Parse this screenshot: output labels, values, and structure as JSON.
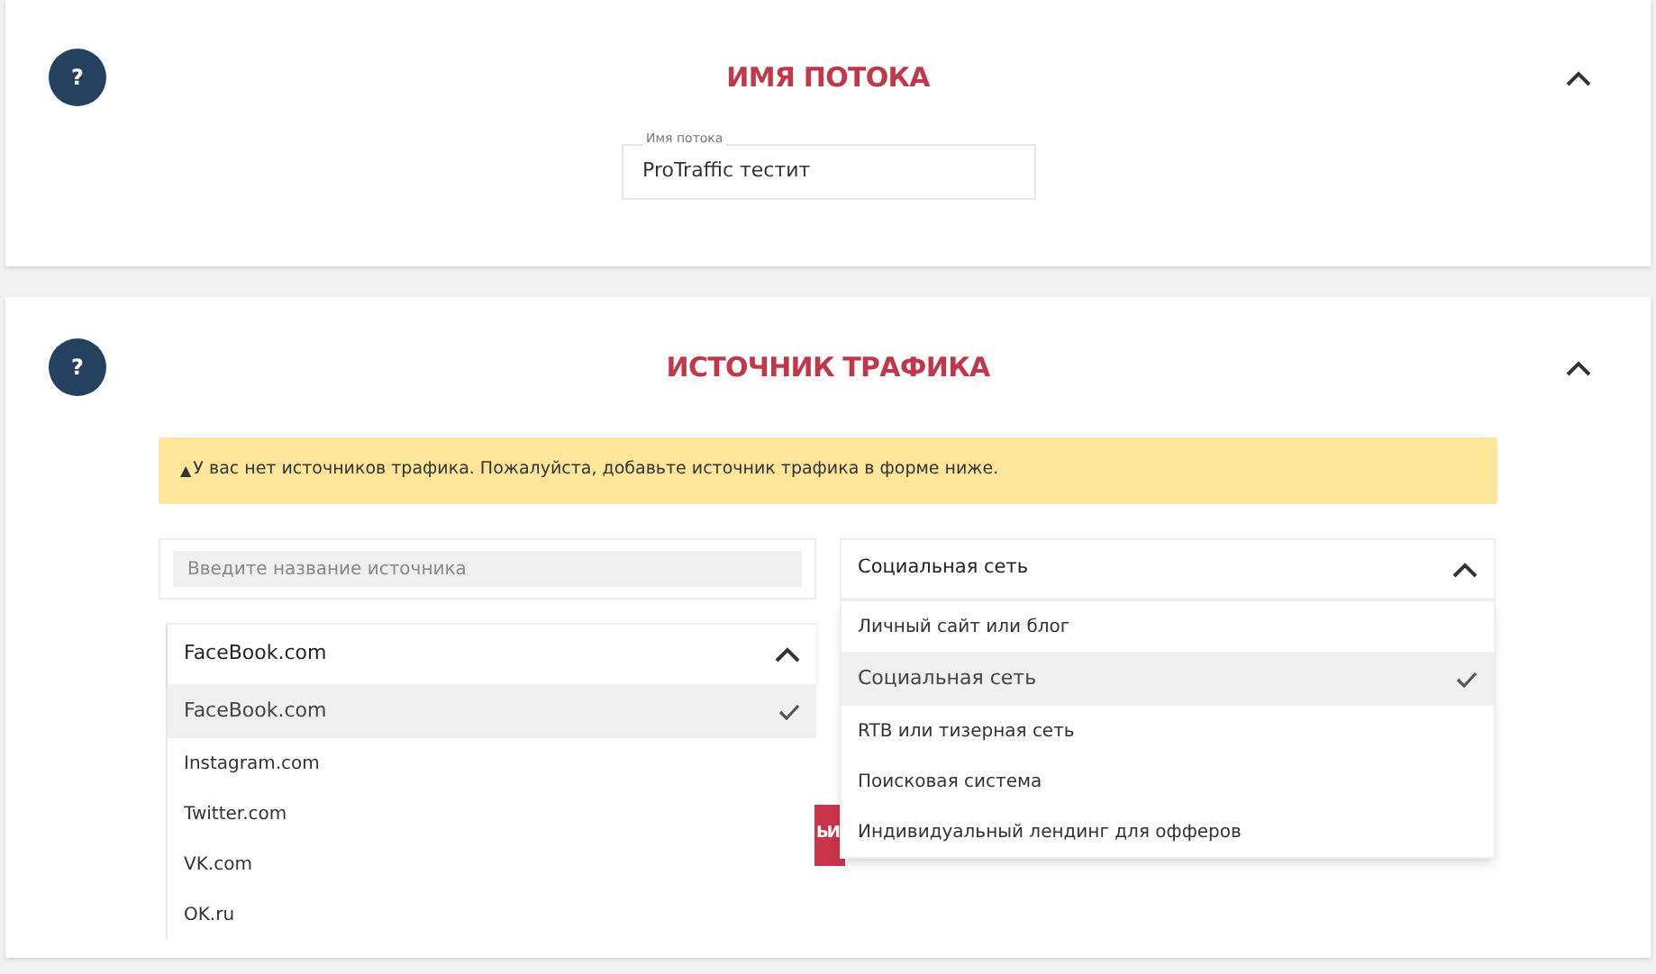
{
  "stream_section": {
    "help": "?",
    "title": "ИМЯ ПОТОКА",
    "expanded": true,
    "field": {
      "label": "Имя потока",
      "value": "ProTraffic тестит"
    }
  },
  "traffic_section": {
    "help": "?",
    "title": "ИСТОЧНИК ТРАФИКА",
    "expanded": true,
    "warning": {
      "icon": "▲",
      "text": "У вас нет источников трафика. Пожалуйста, добавьте источник трафика в форме ниже."
    },
    "name_field": {
      "placeholder": "Введите название источника"
    },
    "source_select": {
      "value": "FaceBook.com",
      "expanded": true,
      "options": [
        {
          "label": "FaceBook.com",
          "selected": true
        },
        {
          "label": "Instagram.com",
          "selected": false
        },
        {
          "label": "Twitter.com",
          "selected": false
        },
        {
          "label": "VK.com",
          "selected": false
        },
        {
          "label": "OK.ru",
          "selected": false
        }
      ]
    },
    "type_select": {
      "value": "Социальная сеть",
      "expanded": true,
      "options": [
        {
          "label": "Личный сайт или блог",
          "selected": false
        },
        {
          "label": "Социальная сеть",
          "selected": true
        },
        {
          "label": "RTB или тизерная сеть",
          "selected": false
        },
        {
          "label": "Поисковая система",
          "selected": false
        },
        {
          "label": "Индивидуальный лендинг для офферов",
          "selected": false
        }
      ]
    },
    "add_button": {
      "label": "ЬИ"
    }
  }
}
